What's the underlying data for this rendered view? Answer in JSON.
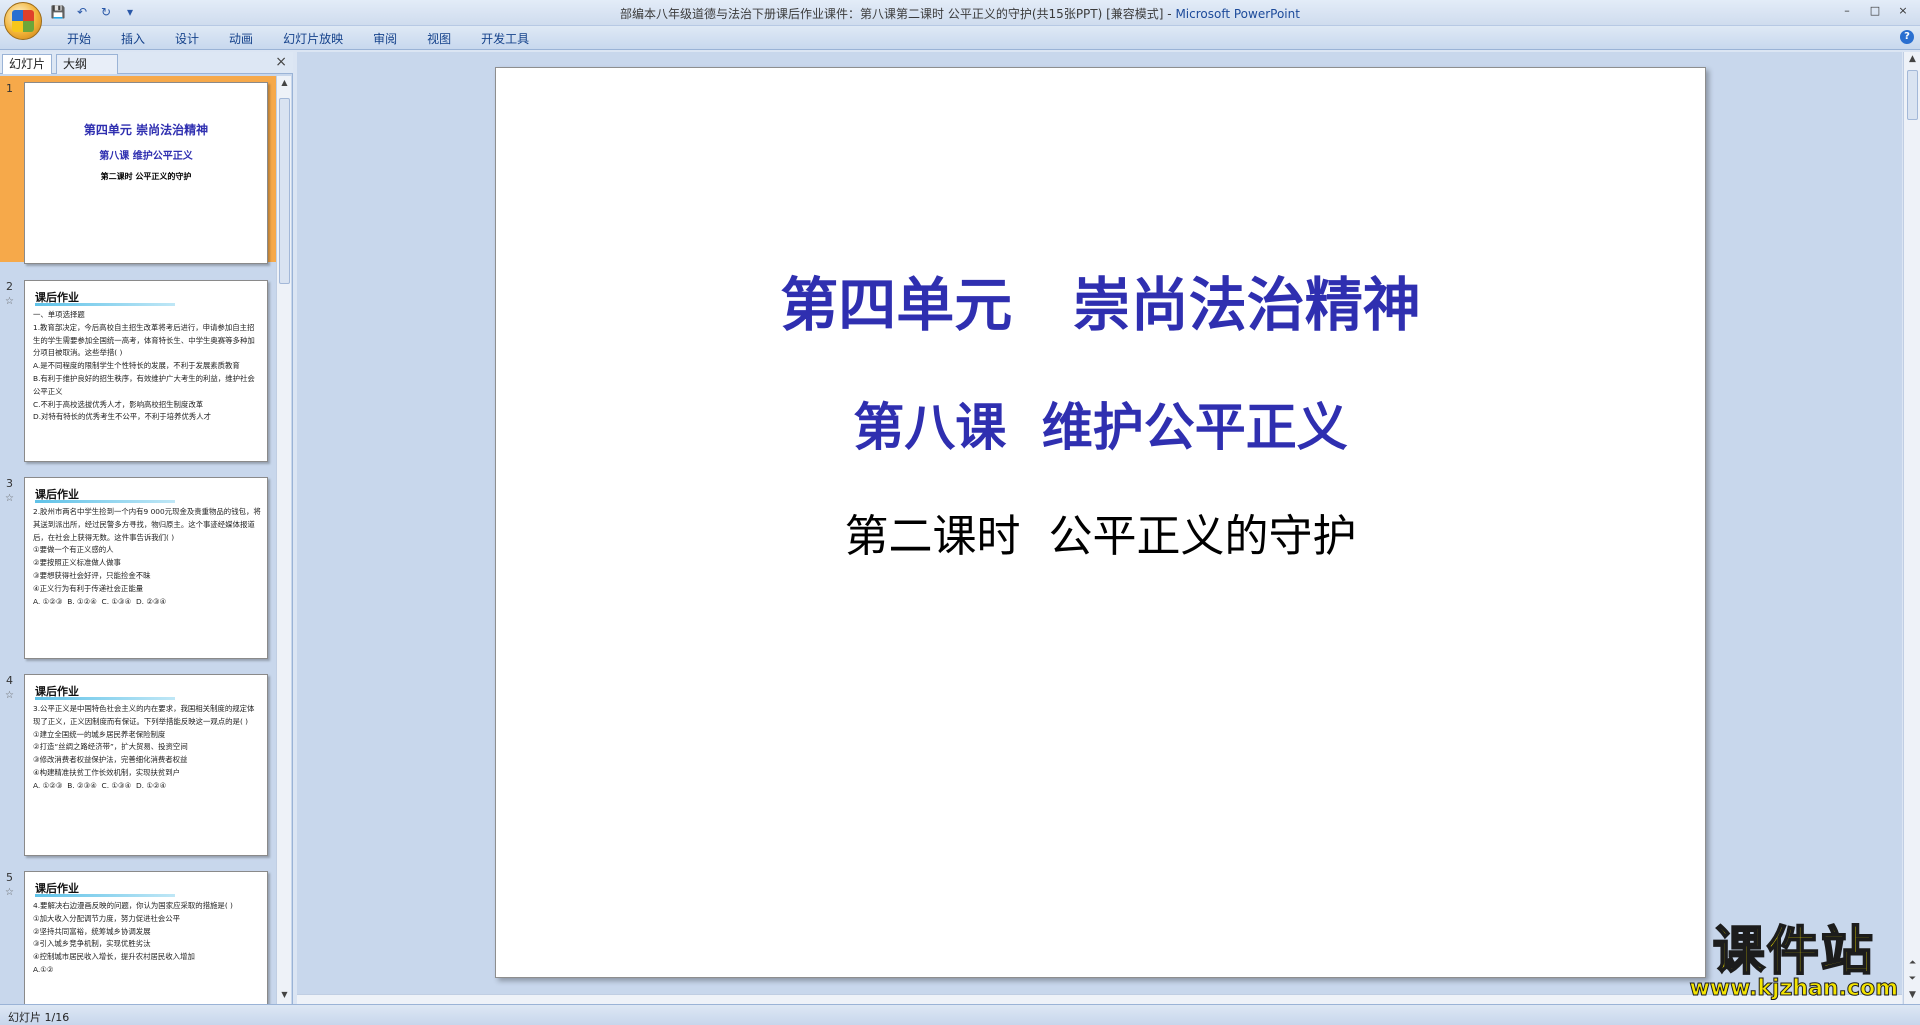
{
  "window": {
    "title": "部编本八年级道德与法治下册课后作业课件：第八课第二课时 公平正义的守护(共15张PPT) [兼容模式] - ",
    "app_name": "Microsoft PowerPoint",
    "controls": [
      "–",
      "□",
      "×"
    ]
  },
  "quick_access": {
    "icons": [
      "save-icon",
      "undo-icon",
      "redo-icon",
      "customize-icon"
    ],
    "glyphs": [
      "💾",
      "↶",
      "↻",
      "▾"
    ]
  },
  "ribbon": {
    "tabs": [
      "开始",
      "插入",
      "设计",
      "动画",
      "幻灯片放映",
      "审阅",
      "视图",
      "开发工具"
    ]
  },
  "left_pane": {
    "tabs": {
      "slides": "幻灯片",
      "outline": "大纲"
    },
    "close": "×",
    "thumbnails": [
      {
        "num": "1",
        "star": "",
        "title_a": "第四单元  崇尚法治精神",
        "title_b": "第八课  维护公平正义",
        "title_c": "第二课时  公平正义的守护"
      },
      {
        "num": "2",
        "star": "☆",
        "title": "课后作业",
        "body": "一、单项选择题\n1.教育部决定，今后高校自主招生改革将考后进行，申请参加自主招生的学生需要参加全国统一高考，体育特长生、中学生奥赛等多种加分项目被取消。这些举措( )\nA.是不同程度的限制学生个性特长的发展，不利于发展素质教育\nB.有利于维护良好的招生秩序，有效维护广大考生的利益，维护社会公平正义\nC.不利于高校选拔优秀人才，影响高校招生制度改革\nD.对特有特长的优秀考生不公平，不利于培养优秀人才"
      },
      {
        "num": "3",
        "star": "☆",
        "title": "课后作业",
        "body": "2.胶州市两名中学生捡到一个内有9 000元现金及贵重物品的钱包，将其送到派出所，经过民警多方寻找，物归原主。这个事迹经媒体报道后，在社会上获得无数。这件事告诉我们( )\n①要做一个有正义感的人\n②要按照正义标准做人做事\n③要想获得社会好评，只能捡金不昧\n④正义行为有利于传递社会正能量\nA. ①②③  B. ①②④  C. ①③④  D. ②③④"
      },
      {
        "num": "4",
        "star": "☆",
        "title": "课后作业",
        "body": "3.公平正义是中国特色社会主义的内在要求，我国相关制度的规定体现了正义，正义因制度而有保证。下列举措能反映这一观点的是( )\n①建立全国统一的城乡居民养老保险制度\n②打造“丝绸之路经济带”，扩大贸易、投资空间\n③修改消费者权益保护法，完善细化消费者权益\n④构建精准扶贫工作长效机制，实现扶贫到户\nA. ①②③  B. ②③④  C. ①③④  D. ①②④"
      },
      {
        "num": "5",
        "star": "☆",
        "title": "课后作业",
        "body": "4.要解决右边漫画反映的问题，你认为国家应采取的措施是( )\n①加大收入分配调节力度，努力促进社会公平\n②坚持共同富裕，统筹城乡协调发展\n③引入城乡竞争机制，实现优胜劣汰\n④控制城市居民收入增长，提升农村居民收入增加\nA.①②"
      }
    ]
  },
  "slide": {
    "title": "第四单元   崇尚法治精神",
    "subtitle": "第八课  维护公平正义",
    "lesson": "第二课时  公平正义的守护"
  },
  "status": {
    "text": "幻灯片 1/16"
  },
  "watermark": {
    "big": "课件站",
    "url": "www.kjzhan.com"
  },
  "colors": {
    "slide_blue": "#2f2fb0",
    "selection_orange": "#f6a94a"
  }
}
